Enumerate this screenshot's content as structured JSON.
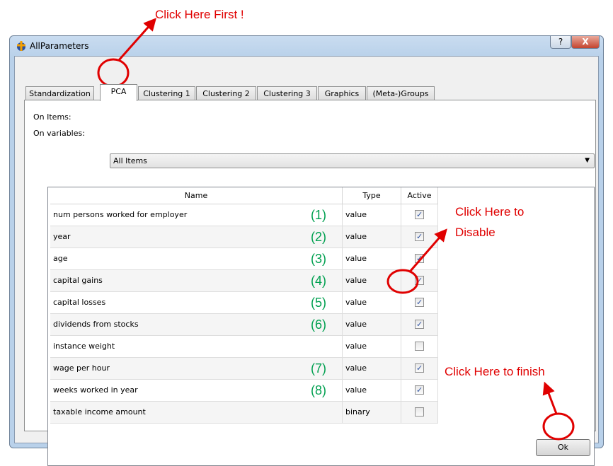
{
  "window": {
    "title": "AllParameters",
    "help": "?",
    "close": "X"
  },
  "tabs": [
    {
      "label": "Standardization"
    },
    {
      "label": "PCA",
      "active": true
    },
    {
      "label": "Clustering 1"
    },
    {
      "label": "Clustering 2"
    },
    {
      "label": "Clustering 3"
    },
    {
      "label": "Graphics"
    },
    {
      "label": "(Meta-)Groups"
    }
  ],
  "on_items": {
    "label": "On Items:",
    "value": "All Items"
  },
  "on_variables": {
    "label": "On variables:"
  },
  "table": {
    "headers": [
      "Name",
      "Type",
      "Active"
    ],
    "rows": [
      {
        "name": "num persons worked for employer",
        "type": "value",
        "active": true,
        "marker": "(1)"
      },
      {
        "name": "year",
        "type": "value",
        "active": true,
        "marker": "(2)"
      },
      {
        "name": "age",
        "type": "value",
        "active": true,
        "marker": "(3)"
      },
      {
        "name": "capital gains",
        "type": "value",
        "active": true,
        "marker": "(4)"
      },
      {
        "name": "capital losses",
        "type": "value",
        "active": true,
        "marker": "(5)"
      },
      {
        "name": "dividends from stocks",
        "type": "value",
        "active": true,
        "marker": "(6)"
      },
      {
        "name": "instance weight",
        "type": "value",
        "active": false,
        "marker": ""
      },
      {
        "name": "wage per hour",
        "type": "value",
        "active": true,
        "marker": "(7)"
      },
      {
        "name": "weeks worked in year",
        "type": "value",
        "active": true,
        "marker": "(8)"
      },
      {
        "name": "taxable income amount",
        "type": "binary",
        "active": false,
        "marker": ""
      }
    ]
  },
  "ok_label": "Ok",
  "annotations": {
    "first": "Click Here First !",
    "disable_1": "Click Here to",
    "disable_2": "Disable",
    "finish": "Click Here to finish",
    "color": "#e00000",
    "marker_color": "#00a050"
  }
}
